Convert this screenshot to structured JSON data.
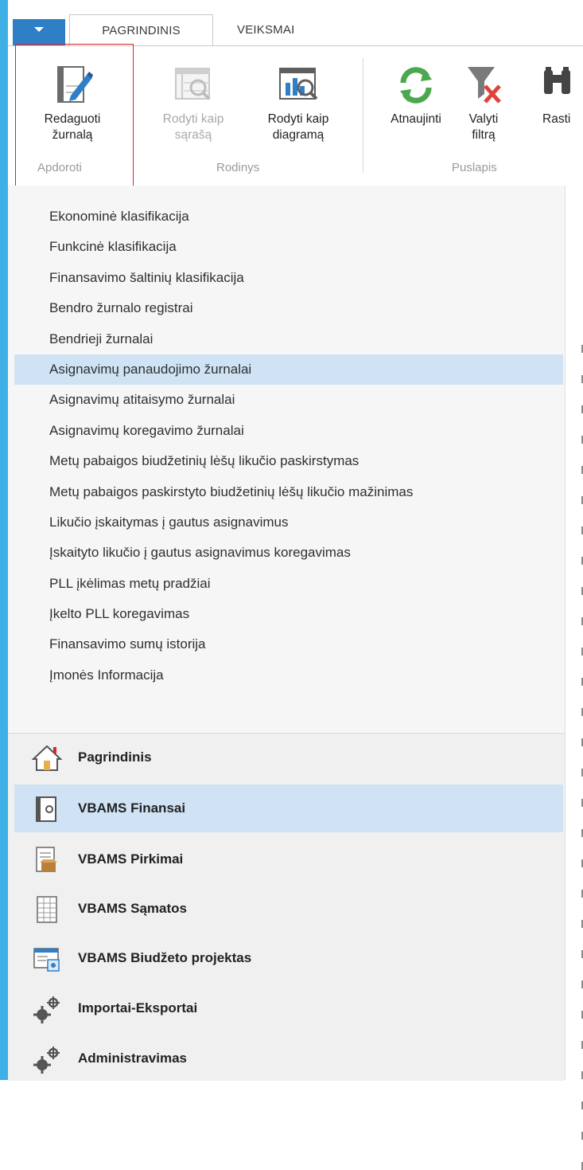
{
  "ribbon": {
    "tabs": [
      "PAGRINDINIS",
      "VEIKSMAI"
    ],
    "active_tab": "PAGRINDINIS",
    "buttons": {
      "edit_journal": {
        "line1": "Redaguoti",
        "line2": "žurnalą",
        "icon": "edit-journal-icon",
        "enabled": true
      },
      "view_list": {
        "line1": "Rodyti kaip",
        "line2": "sąrašą",
        "icon": "view-list-icon",
        "enabled": false
      },
      "view_chart": {
        "line1": "Rodyti kaip",
        "line2": "diagramą",
        "icon": "view-chart-icon",
        "enabled": true
      },
      "refresh": {
        "line1": "Atnaujinti",
        "icon": "refresh-icon",
        "enabled": true
      },
      "clear_filter": {
        "line1": "Valyti",
        "line2": "filtrą",
        "icon": "clear-filter-icon",
        "enabled": true
      },
      "find": {
        "line1": "Rasti",
        "icon": "binoculars-icon",
        "enabled": true
      }
    },
    "groups": [
      "Apdoroti",
      "Rodinys",
      "Puslapis"
    ]
  },
  "pages": {
    "items": [
      "Ekonominė klasifikacija",
      "Funkcinė klasifikacija",
      "Finansavimo šaltinių klasifikacija",
      "Bendro žurnalo registrai",
      "Bendrieji žurnalai",
      "Asignavimų panaudojimo žurnalai",
      "Asignavimų atitaisymo žurnalai",
      "Asignavimų koregavimo žurnalai",
      "Metų pabaigos biudžetinių lėšų likučio paskirstymas",
      "Metų pabaigos paskirstyto biudžetinių lėšų likučio mažinimas",
      "Likučio įskaitymas į gautus asignavimus",
      "Įskaityto likučio į gautus asignavimus koregavimas",
      "PLL įkėlimas metų pradžiai",
      "Įkelto PLL koregavimas",
      "Finansavimo sumų istorija",
      "Įmonės Informacija"
    ],
    "selected": "Asignavimų panaudojimo žurnalai"
  },
  "nav": {
    "items": [
      {
        "label": "Pagrindinis",
        "icon": "home-icon"
      },
      {
        "label": "VBAMS Finansai",
        "icon": "finance-book-icon"
      },
      {
        "label": "VBAMS Pirkimai",
        "icon": "purchases-icon"
      },
      {
        "label": "VBAMS Sąmatos",
        "icon": "estimates-sheet-icon"
      },
      {
        "label": "VBAMS Biudžeto projektas",
        "icon": "budget-project-icon"
      },
      {
        "label": "Importai-Eksportai",
        "icon": "gears-icon"
      },
      {
        "label": "Administravimas",
        "icon": "gears-icon"
      }
    ],
    "selected": "VBAMS Finansai"
  },
  "colors": {
    "accent": "#2f7fc7",
    "stripe": "#3fb0e6",
    "selection": "#cfe3f5",
    "focus_border": "#d8262c",
    "refresh_green": "#4aa84e",
    "clear_red": "#e0413a"
  }
}
